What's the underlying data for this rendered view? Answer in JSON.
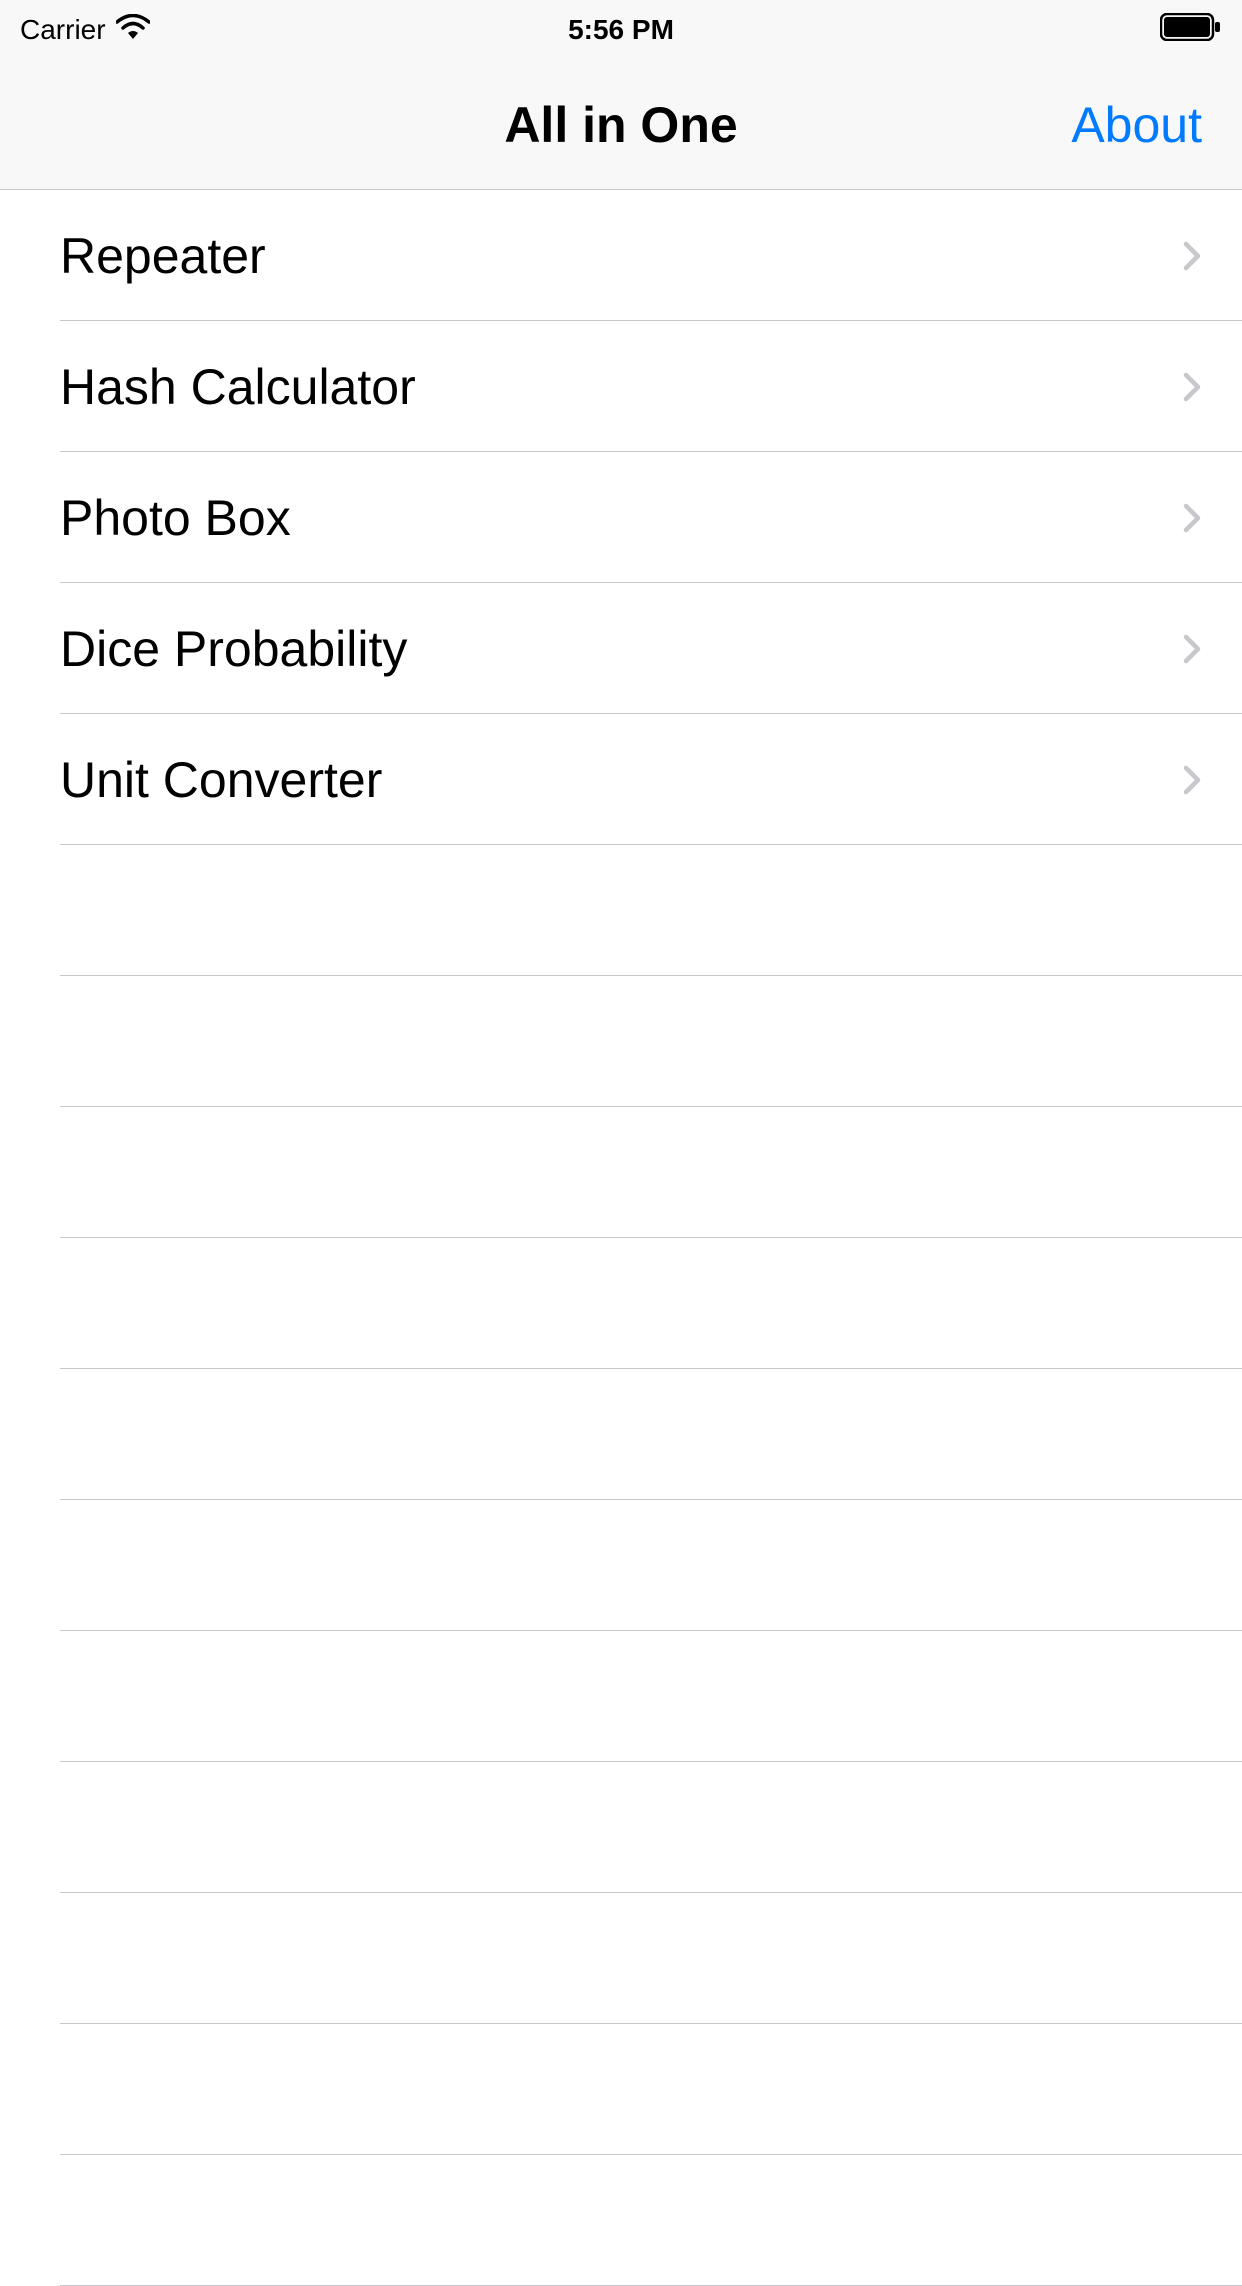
{
  "statusBar": {
    "carrier": "Carrier",
    "time": "5:56 PM"
  },
  "navBar": {
    "title": "All in One",
    "rightButton": "About"
  },
  "list": {
    "items": [
      {
        "label": "Repeater"
      },
      {
        "label": "Hash Calculator"
      },
      {
        "label": "Photo Box"
      },
      {
        "label": "Dice Probability"
      },
      {
        "label": "Unit Converter"
      }
    ]
  }
}
